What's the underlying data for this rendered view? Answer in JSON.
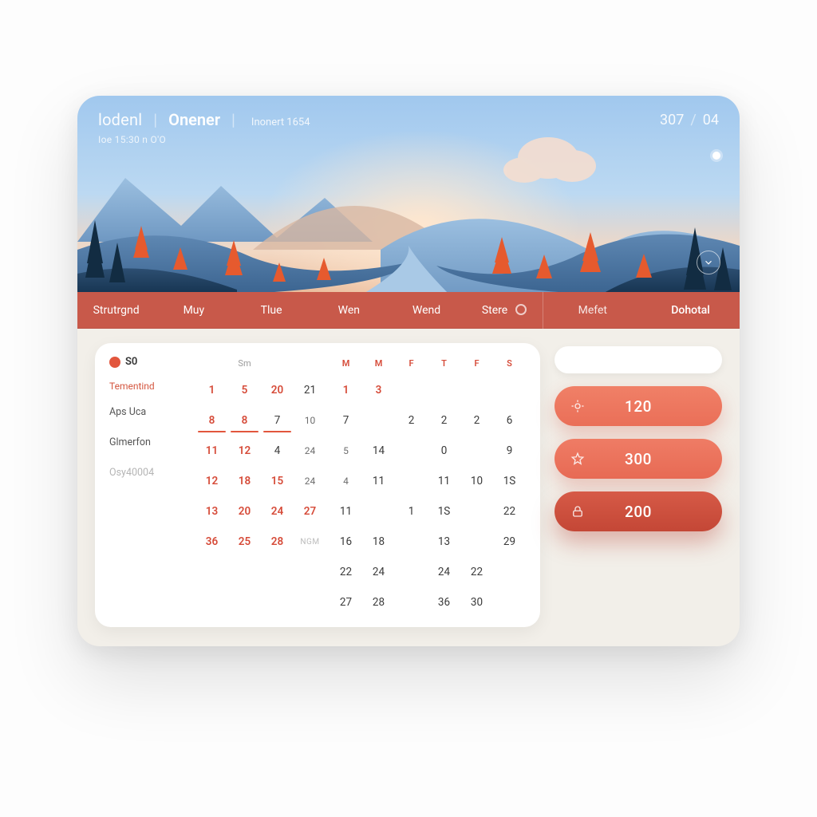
{
  "header": {
    "brand_a": "lodenl",
    "brand_b": "Onener",
    "brand_c": "Inonert 1654",
    "subline": "Ioe 15:30 n O'O",
    "right_a": "307",
    "right_b": "04"
  },
  "tabs": [
    "Strutrgnd",
    "Muy",
    "Tlue",
    "Wen",
    "Wend",
    "Stere",
    "Mefet",
    "Dohotal"
  ],
  "side": {
    "top_value": "S0",
    "label": "Tementind",
    "items": [
      "Aps Uca",
      "Glmerfon",
      "Osy40004"
    ]
  },
  "month_left": {
    "headers": [
      "",
      "Sm",
      "",
      ""
    ],
    "rows": [
      [
        {
          "t": "1",
          "c": "red"
        },
        {
          "t": "5",
          "c": "red"
        },
        {
          "t": "20",
          "c": "red"
        },
        {
          "t": "21",
          "c": ""
        }
      ],
      [
        {
          "t": "8",
          "c": "red",
          "u": true
        },
        {
          "t": "8",
          "c": "red",
          "u": true
        },
        {
          "t": "7",
          "c": "",
          "u": true
        },
        {
          "t": "10",
          "c": "small"
        }
      ],
      [
        {
          "t": "11",
          "c": "red"
        },
        {
          "t": "12",
          "c": "red"
        },
        {
          "t": "4",
          "c": ""
        },
        {
          "t": "24",
          "c": "small"
        }
      ],
      [
        {
          "t": "12",
          "c": "red"
        },
        {
          "t": "18",
          "c": "red"
        },
        {
          "t": "15",
          "c": "red"
        },
        {
          "t": "24",
          "c": "small"
        }
      ],
      [
        {
          "t": "13",
          "c": "red"
        },
        {
          "t": "20",
          "c": "red"
        },
        {
          "t": "24",
          "c": "red"
        },
        {
          "t": "27",
          "c": "red"
        }
      ],
      [
        {
          "t": "36",
          "c": "red"
        },
        {
          "t": "25",
          "c": "red"
        },
        {
          "t": "28",
          "c": "red"
        },
        {
          "t": "NGM",
          "c": "txt"
        }
      ]
    ],
    "extra_col": [
      {
        "t": "",
        "c": ""
      },
      {
        "t": "",
        "c": ""
      },
      {
        "t": "",
        "c": ""
      },
      {
        "t": "",
        "c": ""
      },
      {
        "t": "27",
        "c": "small"
      },
      {
        "t": "",
        "c": ""
      }
    ]
  },
  "month_right": {
    "headers": [
      "M",
      "M",
      "F",
      "T",
      "F",
      "S"
    ],
    "rows": [
      [
        {
          "t": "1",
          "c": "red"
        },
        {
          "t": "3",
          "c": "red"
        },
        {
          "t": "",
          "c": ""
        },
        {
          "t": "",
          "c": ""
        },
        {
          "t": "",
          "c": ""
        },
        {
          "t": "",
          "c": ""
        }
      ],
      [
        {
          "t": "7",
          "c": ""
        },
        {
          "t": "",
          "c": ""
        },
        {
          "t": "2",
          "c": ""
        },
        {
          "t": "2",
          "c": ""
        },
        {
          "t": "2",
          "c": ""
        },
        {
          "t": "6",
          "c": ""
        }
      ],
      [
        {
          "t": "5",
          "c": "small"
        },
        {
          "t": "14",
          "c": ""
        },
        {
          "t": "",
          "c": ""
        },
        {
          "t": "0",
          "c": ""
        },
        {
          "t": "",
          "c": ""
        },
        {
          "t": "9",
          "c": ""
        }
      ],
      [
        {
          "t": "4",
          "c": "small"
        },
        {
          "t": "11",
          "c": ""
        },
        {
          "t": "",
          "c": ""
        },
        {
          "t": "11",
          "c": ""
        },
        {
          "t": "10",
          "c": ""
        },
        {
          "t": "1S",
          "c": ""
        }
      ],
      [
        {
          "t": "11",
          "c": ""
        },
        {
          "t": "",
          "c": ""
        },
        {
          "t": "1",
          "c": ""
        },
        {
          "t": "1S",
          "c": ""
        },
        {
          "t": "",
          "c": ""
        },
        {
          "t": "22",
          "c": ""
        }
      ],
      [
        {
          "t": "16",
          "c": ""
        },
        {
          "t": "18",
          "c": ""
        },
        {
          "t": "",
          "c": ""
        },
        {
          "t": "13",
          "c": ""
        },
        {
          "t": "",
          "c": ""
        },
        {
          "t": "29",
          "c": ""
        }
      ],
      [
        {
          "t": "22",
          "c": ""
        },
        {
          "t": "24",
          "c": ""
        },
        {
          "t": "",
          "c": ""
        },
        {
          "t": "24",
          "c": ""
        },
        {
          "t": "22",
          "c": ""
        },
        {
          "t": "",
          "c": ""
        }
      ],
      [
        {
          "t": "27",
          "c": ""
        },
        {
          "t": "28",
          "c": ""
        },
        {
          "t": "",
          "c": ""
        },
        {
          "t": "36",
          "c": ""
        },
        {
          "t": "30",
          "c": ""
        },
        {
          "t": "",
          "c": ""
        }
      ]
    ]
  },
  "rail": {
    "search_placeholder": "",
    "pills": [
      {
        "value": "120",
        "icon": "sun"
      },
      {
        "value": "300",
        "icon": "star"
      },
      {
        "value": "200",
        "icon": "lock"
      }
    ]
  }
}
